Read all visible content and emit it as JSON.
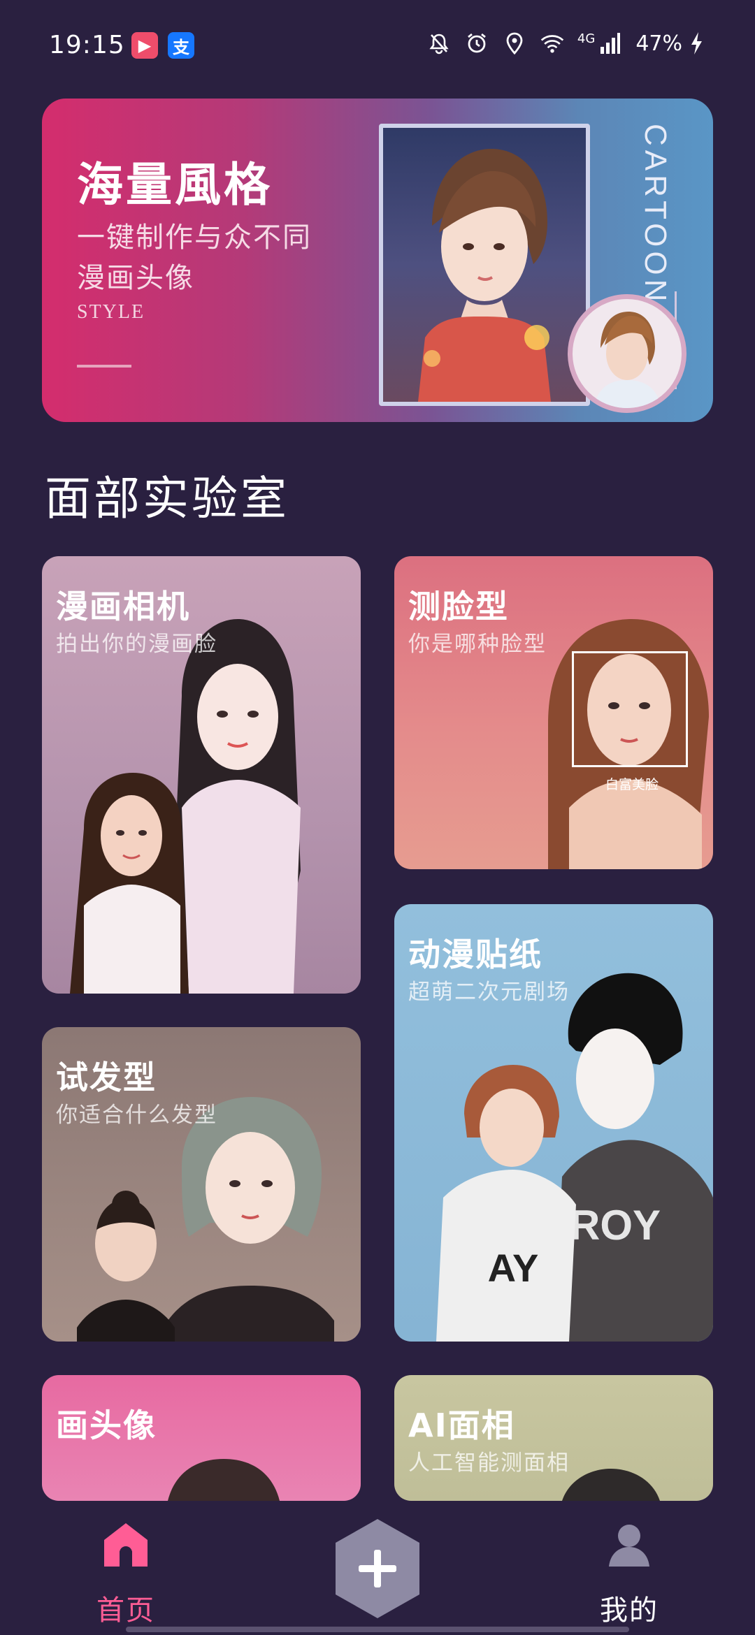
{
  "status_bar": {
    "time": "19:15",
    "app_icons": [
      {
        "name": "video-app-icon",
        "glyph": "▶",
        "color": "#ef4d6b"
      },
      {
        "name": "alipay-icon",
        "glyph": "支",
        "color": "#1677ff"
      }
    ],
    "network": "4G",
    "battery": "47%"
  },
  "banner": {
    "title": "海量風格",
    "subtitle_1": "一键制作与众不同",
    "subtitle_2": "漫画头像",
    "style_text": "STYLE",
    "cartoon_text": "CARTOON"
  },
  "section": {
    "title": "面部实验室"
  },
  "cards": {
    "manga_camera": {
      "title": "漫画相机",
      "subtitle": "拍出你的漫画脸"
    },
    "face_shape": {
      "title": "测脸型",
      "subtitle": "你是哪种脸型",
      "face_label": "白富美脸"
    },
    "anime_sticker": {
      "title": "动漫贴纸",
      "subtitle": "超萌二次元剧场"
    },
    "hairstyle": {
      "title": "试发型",
      "subtitle": "你适合什么发型"
    },
    "avatar": {
      "title": "画头像"
    },
    "ai_face": {
      "title": "AI面相",
      "subtitle": "人工智能测面相"
    }
  },
  "nav": {
    "home_label": "首页",
    "me_label": "我的",
    "active_color": "#ff5d95",
    "add_icon": "plus-hexagon-icon"
  }
}
